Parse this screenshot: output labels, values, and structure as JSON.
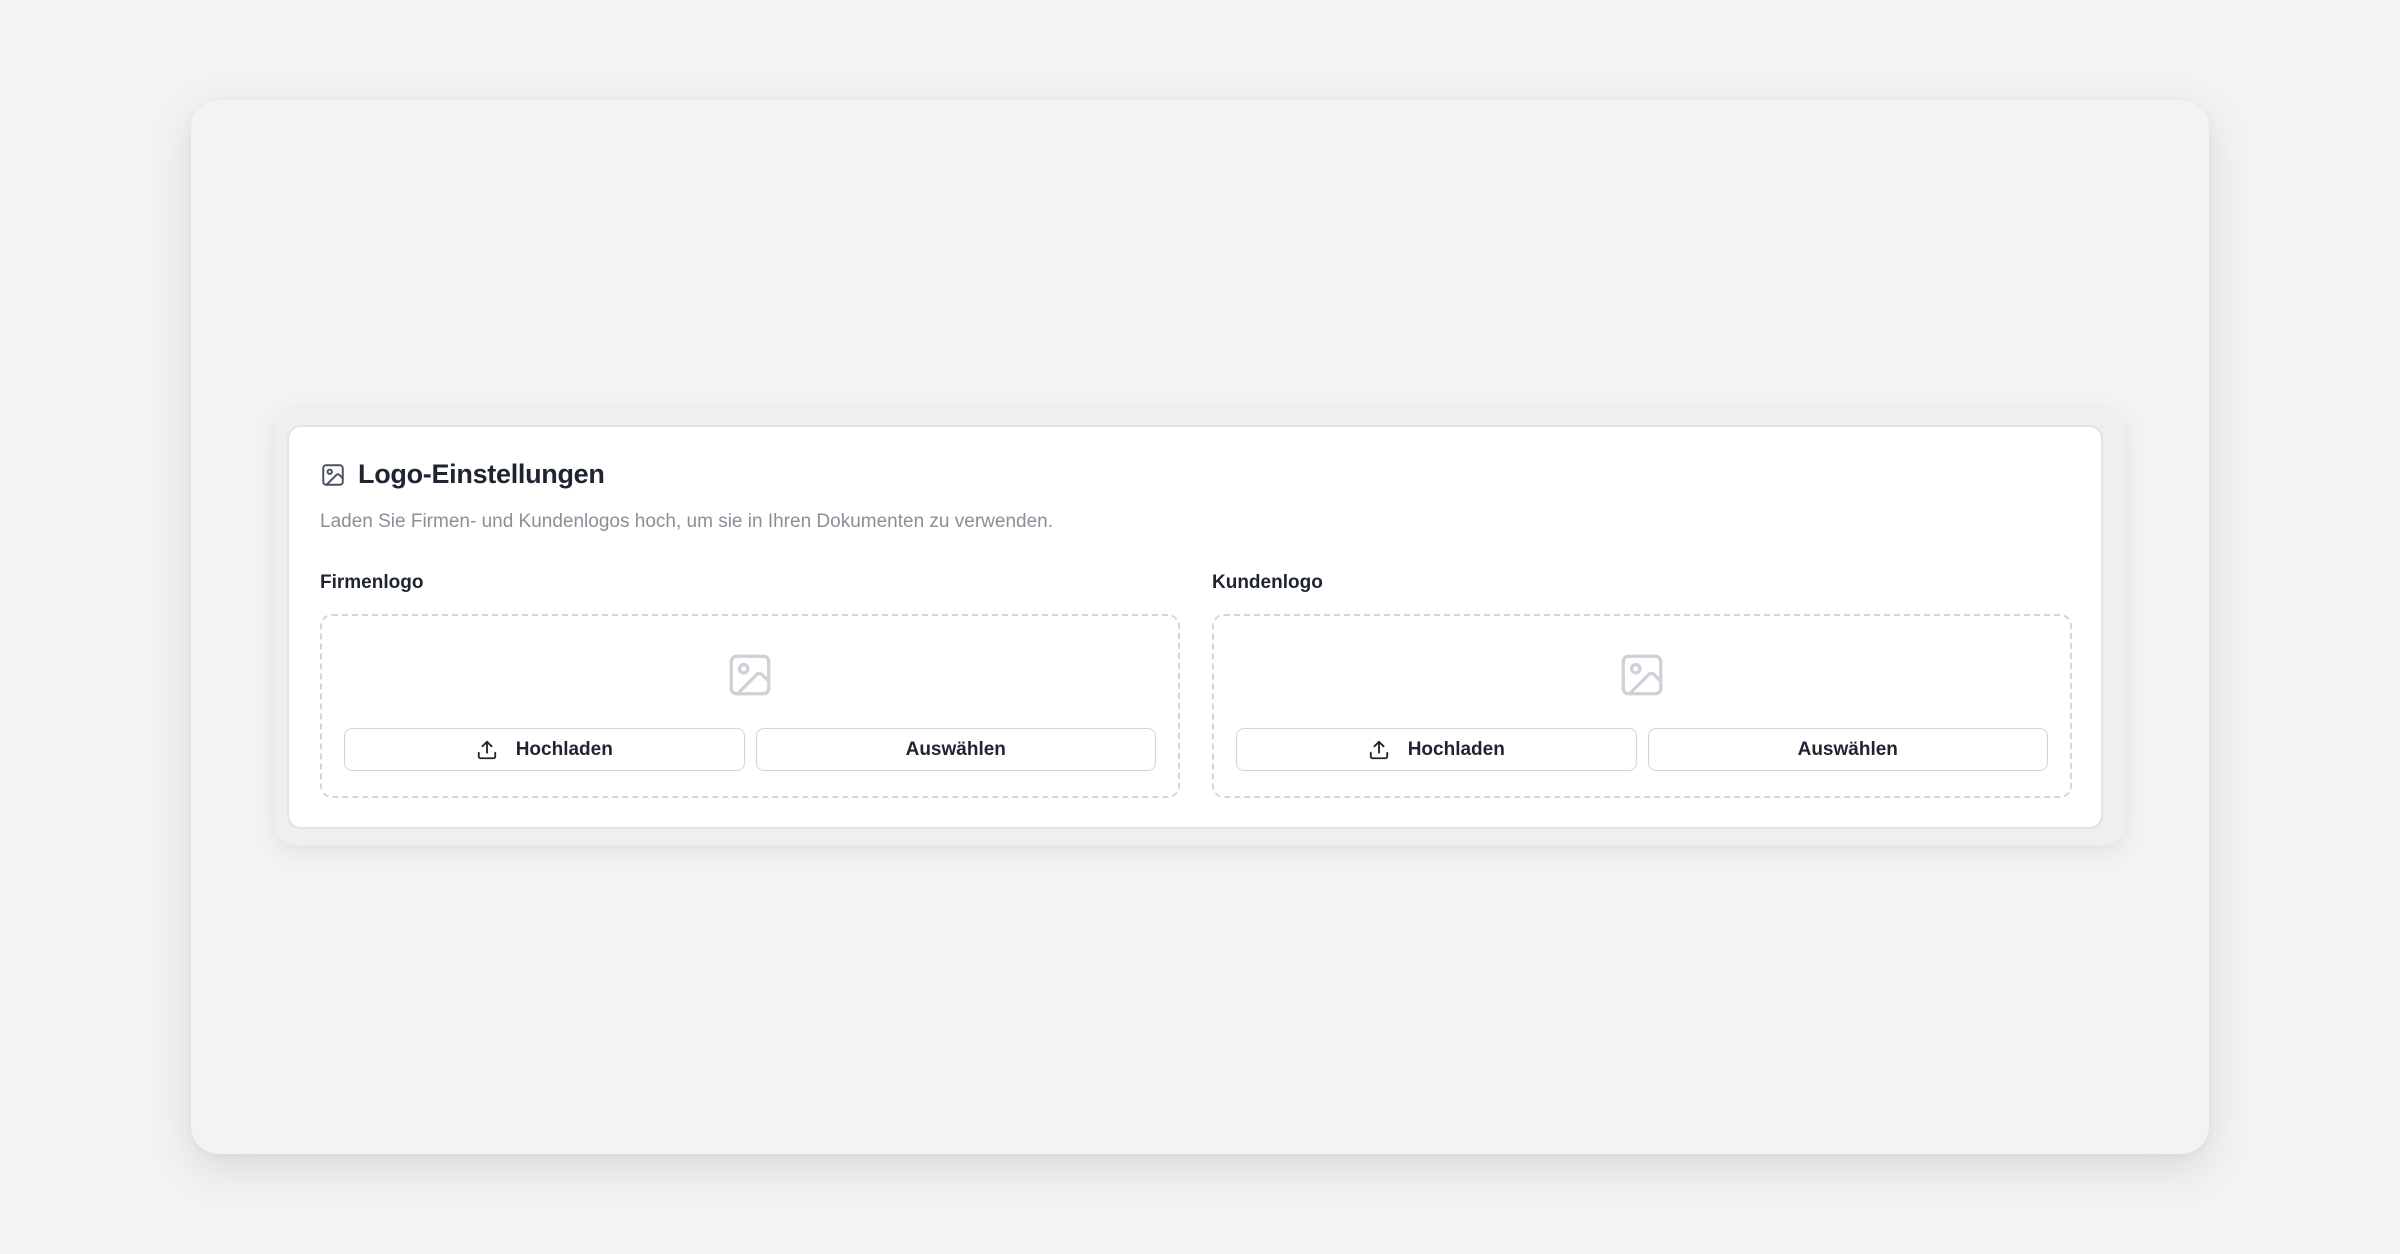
{
  "logo_settings": {
    "title": "Logo-Einstellungen",
    "description": "Laden Sie Firmen- und Kundenlogos hoch, um sie in Ihren Dokumenten zu verwenden.",
    "title_icon": "image-icon",
    "sections": [
      {
        "label": "Firmenlogo",
        "placeholder_icon": "image-placeholder-icon",
        "upload_label": "Hochladen",
        "upload_icon": "upload-icon",
        "select_label": "Auswählen"
      },
      {
        "label": "Kundenlogo",
        "placeholder_icon": "image-placeholder-icon",
        "upload_label": "Hochladen",
        "upload_icon": "upload-icon",
        "select_label": "Auswählen"
      }
    ]
  },
  "colors": {
    "background": "#f3f3f3",
    "card": "#ffffff",
    "text_primary": "#1f2530",
    "text_muted": "#8a8f96",
    "dashed_border": "#d6d6d6",
    "placeholder_icon": "#cdd2d8"
  }
}
